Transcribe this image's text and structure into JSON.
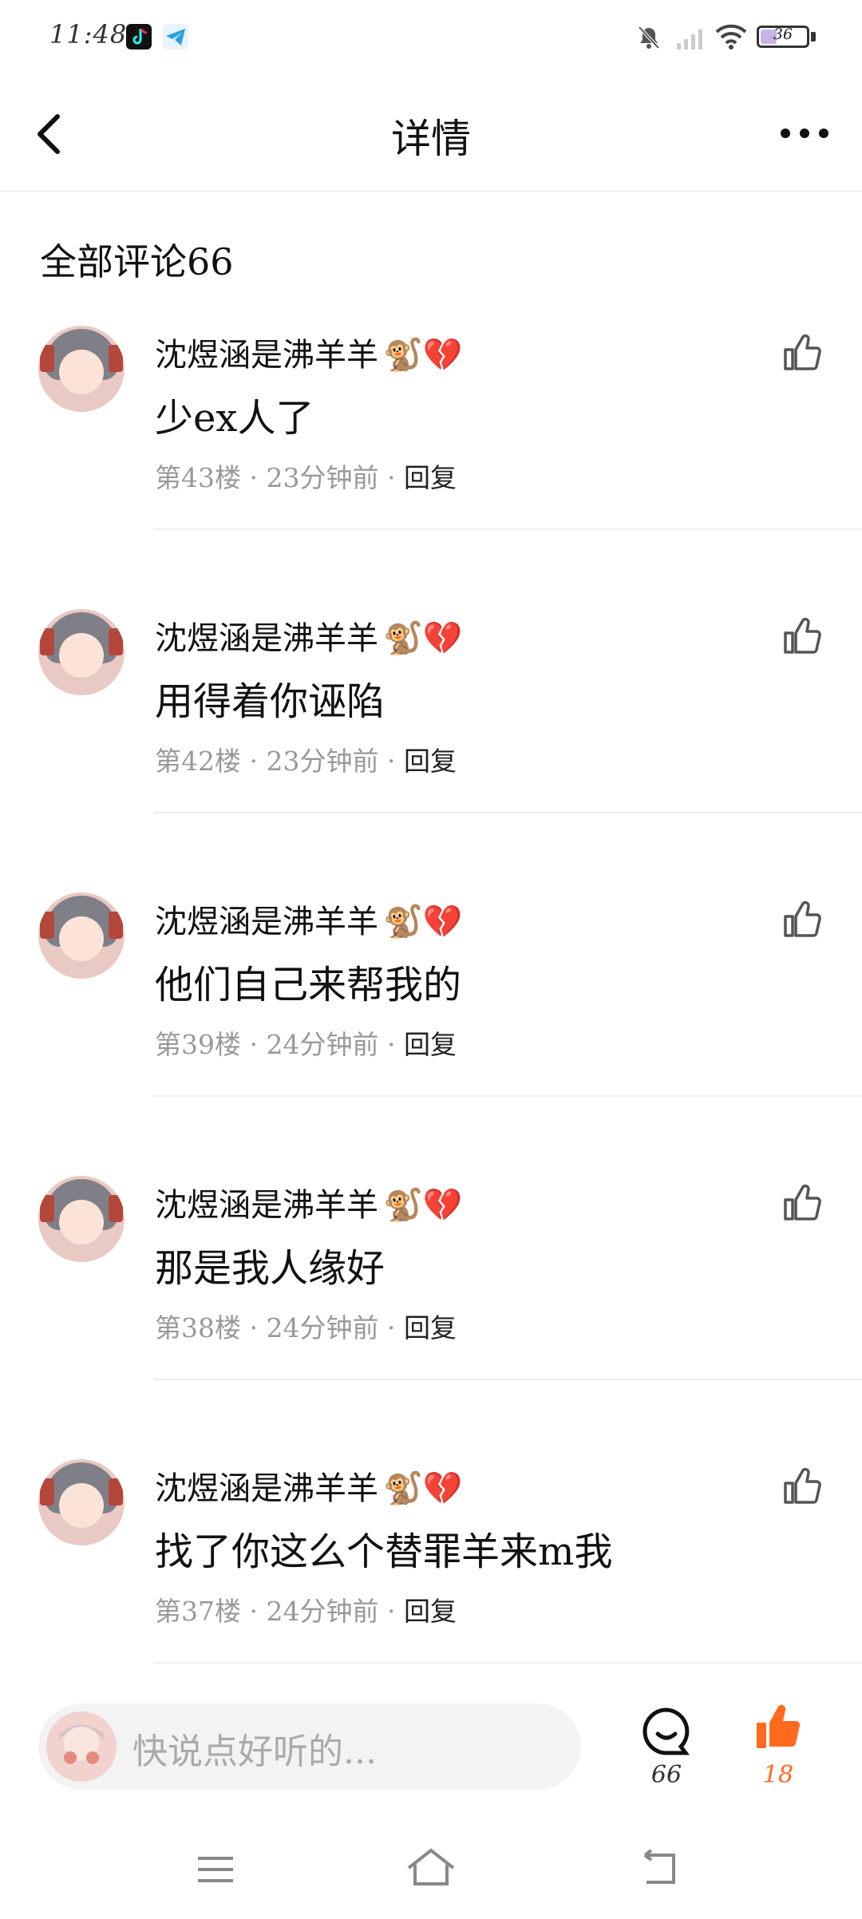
{
  "status_bar": {
    "time": "11:48",
    "battery": "36",
    "battery_level": 0.36,
    "icons": [
      "tiktok-icon",
      "telegram-icon",
      "bell-off-icon",
      "signal-icon",
      "wifi-icon",
      "battery-icon"
    ]
  },
  "nav": {
    "title": "详情",
    "back_icon": "chevron-left-icon",
    "more_icon": "more-icon"
  },
  "section": {
    "title": "全部评论66"
  },
  "comments": [
    {
      "name": "沈煜涵是沸羊羊",
      "emoji": "🐒💔",
      "text": "少ex人了",
      "floor": "第43楼",
      "time": "23分钟前",
      "reply": "回复"
    },
    {
      "name": "沈煜涵是沸羊羊",
      "emoji": "🐒💔",
      "text": "用得着你诬陷",
      "floor": "第42楼",
      "time": "23分钟前",
      "reply": "回复"
    },
    {
      "name": "沈煜涵是沸羊羊",
      "emoji": "🐒💔",
      "text": "他们自己来帮我的",
      "floor": "第39楼",
      "time": "24分钟前",
      "reply": "回复"
    },
    {
      "name": "沈煜涵是沸羊羊",
      "emoji": "🐒💔",
      "text": "那是我人缘好",
      "floor": "第38楼",
      "time": "24分钟前",
      "reply": "回复"
    },
    {
      "name": "沈煜涵是沸羊羊",
      "emoji": "🐒💔",
      "text": "找了你这么个替罪羊来m我",
      "floor": "第37楼",
      "time": "24分钟前",
      "reply": "回复"
    }
  ],
  "bottom_bar": {
    "placeholder": "快说点好听的...",
    "comment_count": "66",
    "like_count": "18",
    "like_color": "#ff6a1f"
  },
  "system_nav": [
    "menu-icon",
    "home-icon",
    "back-icon"
  ]
}
